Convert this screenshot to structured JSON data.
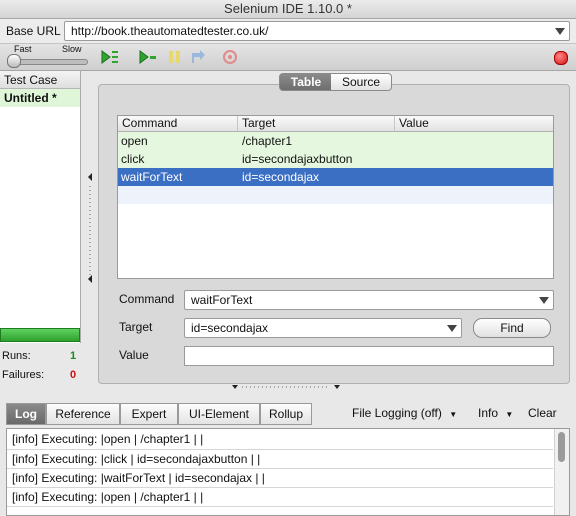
{
  "window": {
    "title": "Selenium IDE 1.10.0 *"
  },
  "base_url": {
    "label": "Base URL",
    "value": "http://book.theautomatedtester.co.uk/"
  },
  "toolbar": {
    "speed_fast": "Fast",
    "speed_slow": "Slow",
    "icons": [
      "play-all-icon",
      "play-current-icon",
      "pause-icon",
      "step-icon",
      "rollup-icon",
      "record-icon"
    ]
  },
  "test_case_panel": {
    "header": "Test Case",
    "items": [
      {
        "label": "Untitled *"
      }
    ],
    "runs_label": "Runs:",
    "runs_value": "1",
    "failures_label": "Failures:",
    "failures_value": "0"
  },
  "view_tabs": {
    "table": "Table",
    "source": "Source"
  },
  "command_table": {
    "headers": [
      "Command",
      "Target",
      "Value"
    ],
    "rows": [
      {
        "command": "open",
        "target": "/chapter1",
        "value": ""
      },
      {
        "command": "click",
        "target": "id=secondajaxbutton",
        "value": ""
      },
      {
        "command": "waitForText",
        "target": "id=secondajax",
        "value": ""
      }
    ],
    "selected_index": 2
  },
  "editor": {
    "command_label": "Command",
    "command_value": "waitForText",
    "target_label": "Target",
    "target_value": "id=secondajax",
    "find_button": "Find",
    "value_label": "Value",
    "value_value": ""
  },
  "log_panel": {
    "tabs": [
      "Log",
      "Reference",
      "Expert",
      "UI-Element",
      "Rollup"
    ],
    "active_tab": "Log",
    "file_logging": "File Logging (off)",
    "info": "Info",
    "clear": "Clear",
    "lines": [
      "[info] Executing: |open | /chapter1 | |",
      "[info] Executing: |click | id=secondajaxbutton | |",
      "[info] Executing: |waitForText | id=secondajax | |",
      "[info] Executing: |open | /chapter1 | |"
    ]
  },
  "colors": {
    "selected_row": "#3b6fc4",
    "executed_row": "#e5f8df",
    "runs_value": "#1a8a1a",
    "failures_value": "#cc1111"
  }
}
